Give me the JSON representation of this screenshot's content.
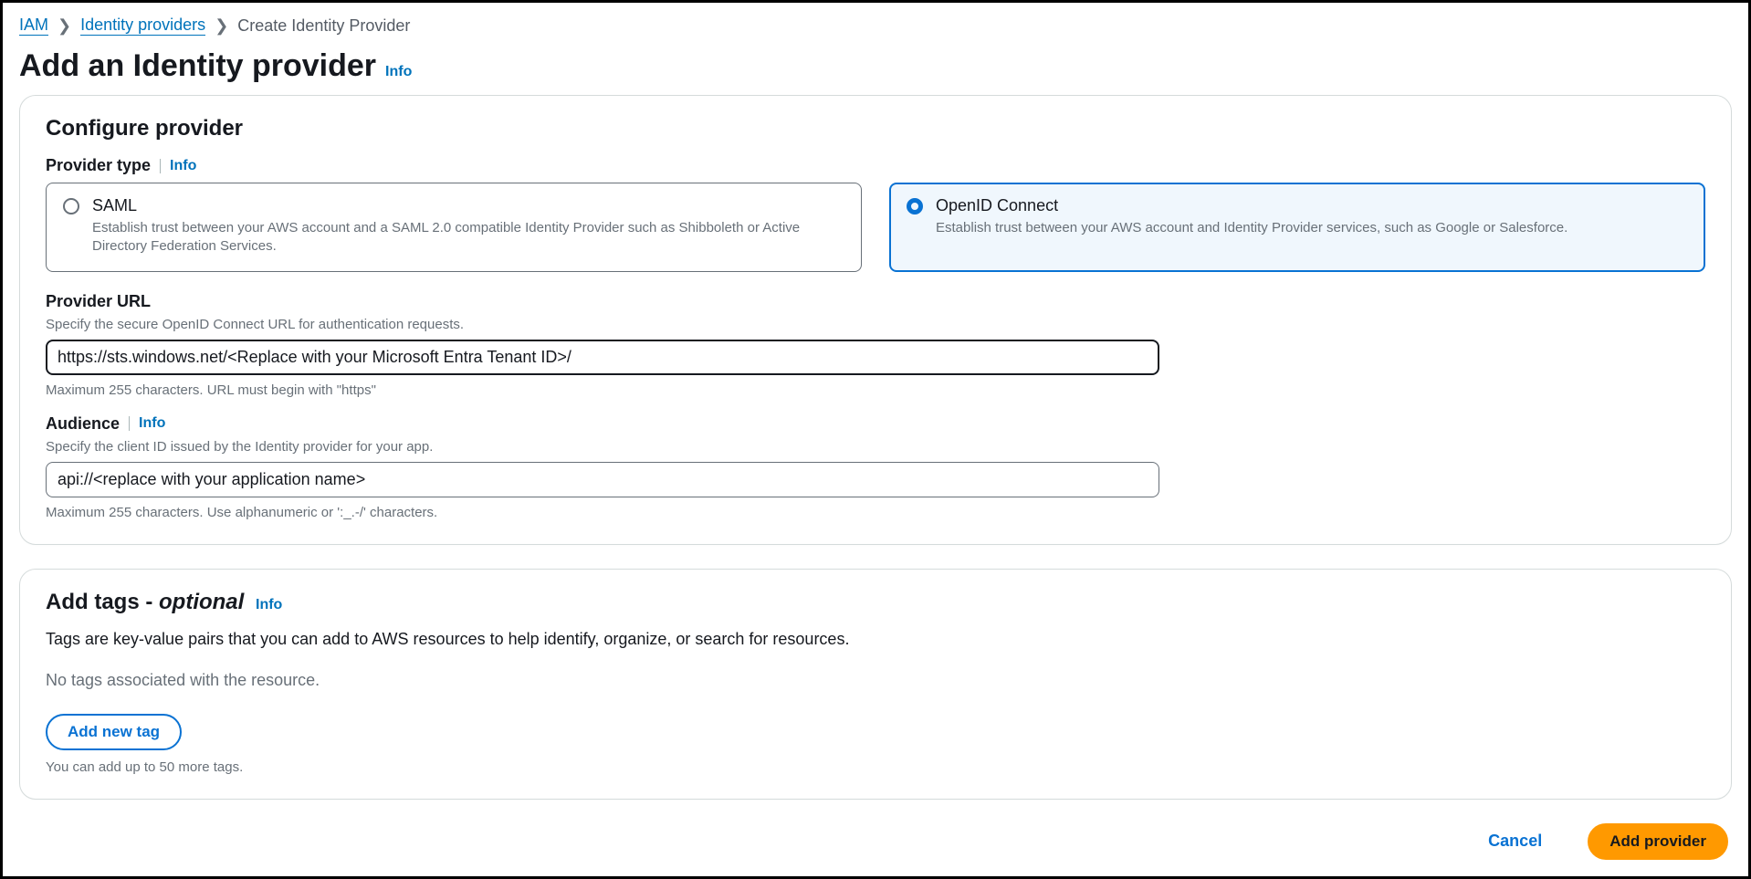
{
  "breadcrumb": {
    "items": [
      "IAM",
      "Identity providers",
      "Create Identity Provider"
    ]
  },
  "page": {
    "title": "Add an Identity provider",
    "info": "Info"
  },
  "configure": {
    "heading": "Configure provider",
    "provider_type_label": "Provider type",
    "provider_type_info": "Info",
    "tiles": {
      "saml": {
        "title": "SAML",
        "desc": "Establish trust between your AWS account and a SAML 2.0 compatible Identity Provider such as Shibboleth or Active Directory Federation Services.",
        "selected": false
      },
      "oidc": {
        "title": "OpenID Connect",
        "desc": "Establish trust between your AWS account and Identity Provider services, such as Google or Salesforce.",
        "selected": true
      }
    },
    "provider_url": {
      "label": "Provider URL",
      "hint": "Specify the secure OpenID Connect URL for authentication requests.",
      "value": "https://sts.windows.net/<Replace with your Microsoft Entra Tenant ID>/",
      "constraint": "Maximum 255 characters. URL must begin with \"https\""
    },
    "audience": {
      "label": "Audience",
      "info": "Info",
      "hint": "Specify the client ID issued by the Identity provider for your app.",
      "value": "api://<replace with your application name>",
      "constraint": "Maximum 255 characters. Use alphanumeric or ':_.-/' characters."
    }
  },
  "tags": {
    "heading_prefix": "Add tags - ",
    "heading_optional": "optional",
    "info": "Info",
    "desc": "Tags are key-value pairs that you can add to AWS resources to help identify, organize, or search for resources.",
    "empty": "No tags associated with the resource.",
    "add_button": "Add new tag",
    "limit_hint": "You can add up to 50 more tags."
  },
  "actions": {
    "cancel": "Cancel",
    "submit": "Add provider"
  }
}
